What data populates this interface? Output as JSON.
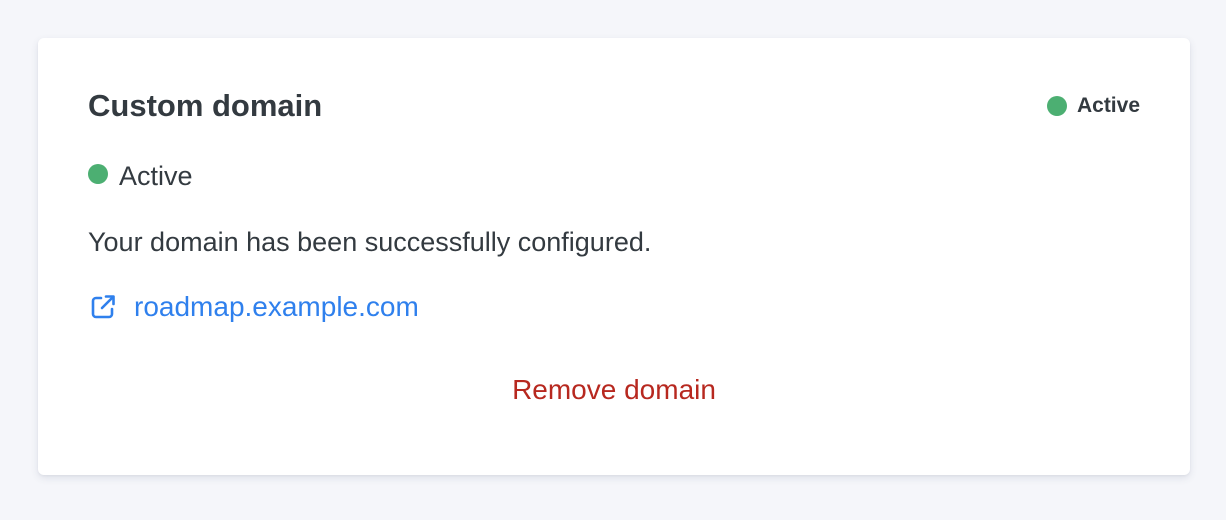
{
  "card": {
    "title": "Custom domain"
  },
  "header_status": {
    "label": "Active",
    "dot_color": "#4caf72"
  },
  "status": {
    "label": "Active",
    "dot_color": "#4caf72"
  },
  "message": "Your domain has been successfully configured.",
  "domain_link": {
    "text": "roadmap.example.com",
    "icon": "external-link-icon",
    "color": "#2f80ed"
  },
  "remove_button": {
    "label": "Remove domain",
    "color": "#b7281f"
  }
}
